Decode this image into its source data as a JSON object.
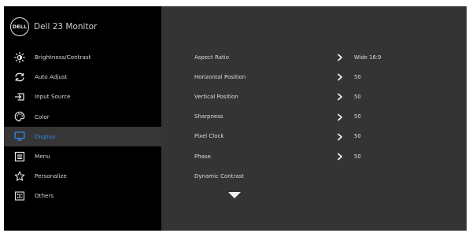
{
  "header": {
    "logo_text": "DELL",
    "title": "Dell 23 Monitor"
  },
  "sidebar": {
    "items": [
      {
        "label": "Brightness/Contrast",
        "icon": "brightness-icon"
      },
      {
        "label": "Auto Adjust",
        "icon": "auto-adjust-icon"
      },
      {
        "label": "Input Source",
        "icon": "input-source-icon"
      },
      {
        "label": "Color",
        "icon": "color-palette-icon"
      },
      {
        "label": "Display",
        "icon": "display-monitor-icon",
        "active": true
      },
      {
        "label": "Menu",
        "icon": "menu-icon"
      },
      {
        "label": "Personalize",
        "icon": "star-icon"
      },
      {
        "label": "Others",
        "icon": "others-icon"
      }
    ]
  },
  "settings": {
    "rows": [
      {
        "label": "Aspect Ratio",
        "value": "Wide 16:9"
      },
      {
        "label": "Horizontal Position",
        "value": "50"
      },
      {
        "label": "Vertical Position",
        "value": "50"
      },
      {
        "label": "Sharpness",
        "value": "50"
      },
      {
        "label": "Pixel Clock",
        "value": "50"
      },
      {
        "label": "Phase",
        "value": "50"
      },
      {
        "label": "Dynamic Contrast",
        "value": ""
      }
    ],
    "more_indicator_icon": "triangle-down-icon"
  },
  "colors": {
    "background": "#000000",
    "panel": "#343434",
    "active_row": "#363636",
    "accent": "#2f89e5",
    "text": "#dcdcdc"
  }
}
